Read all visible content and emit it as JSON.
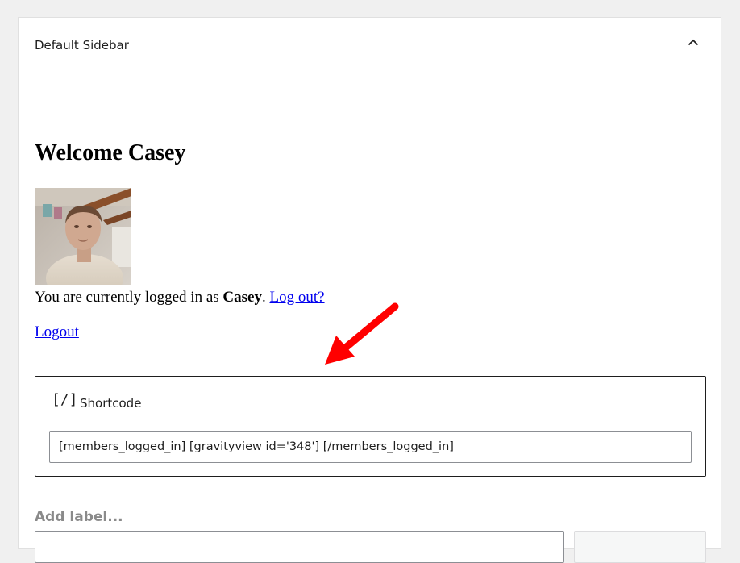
{
  "sidebar_panel": {
    "title": "Default Sidebar",
    "collapse_icon": "chevron-up-icon"
  },
  "content": {
    "welcome_heading": "Welcome Casey",
    "logged_in_prefix": "You are currently logged in as ",
    "logged_in_user": "Casey",
    "logged_in_period": ".",
    "logout_question_link": "Log out?",
    "logout_link": "Logout"
  },
  "shortcode_block": {
    "icon": "shortcode-icon",
    "icon_glyph": "[/]",
    "title": "Shortcode",
    "value": "[members_logged_in] [gravityview id='348'] [/members_logged_in]"
  },
  "label_field": {
    "placeholder": "Add label..."
  },
  "colors": {
    "annotation_arrow": "#ff0000",
    "link": "#0000ee"
  }
}
